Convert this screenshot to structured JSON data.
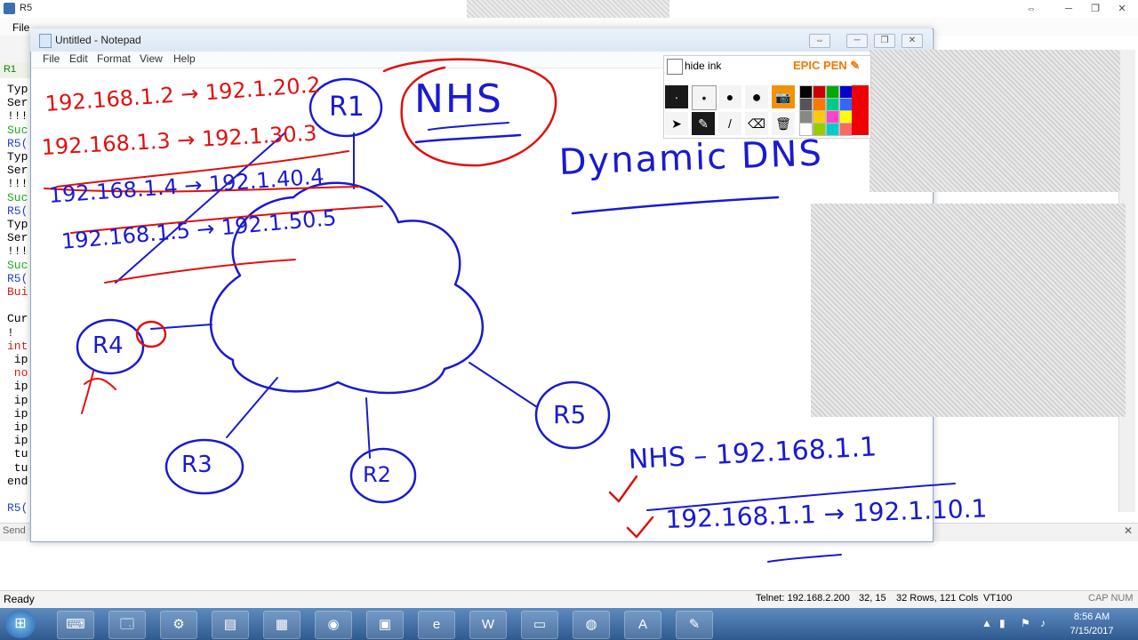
{
  "terminal": {
    "title": "R5",
    "menu_file": "File",
    "tab_label": "R1",
    "send_label": "Send",
    "lines": [
      {
        "text": "Typ",
        "color": "#000000"
      },
      {
        "text": "Ser",
        "color": "#000000"
      },
      {
        "text": "!!!",
        "color": "#000000"
      },
      {
        "text": "Suc",
        "color": "#22aa22"
      },
      {
        "text": "R5(",
        "color": "#2244cc"
      },
      {
        "text": "Typ",
        "color": "#000000"
      },
      {
        "text": "Ser",
        "color": "#000000"
      },
      {
        "text": "!!!",
        "color": "#000000"
      },
      {
        "text": "Suc",
        "color": "#22aa22"
      },
      {
        "text": "R5(",
        "color": "#2244cc"
      },
      {
        "text": "Typ",
        "color": "#000000"
      },
      {
        "text": "Ser",
        "color": "#000000"
      },
      {
        "text": "!!!",
        "color": "#000000"
      },
      {
        "text": "Suc",
        "color": "#22aa22"
      },
      {
        "text": "R5(",
        "color": "#2244cc"
      },
      {
        "text": "Bui",
        "color": "#cc2222"
      },
      {
        "text": "",
        "color": "#000000"
      },
      {
        "text": "Cur",
        "color": "#000000"
      },
      {
        "text": "!",
        "color": "#000000"
      },
      {
        "text": "int",
        "color": "#cc2222"
      },
      {
        "text": " ip",
        "color": "#000000"
      },
      {
        "text": " no",
        "color": "#cc2222"
      },
      {
        "text": " ip",
        "color": "#000000"
      },
      {
        "text": " ip",
        "color": "#000000"
      },
      {
        "text": " ip",
        "color": "#000000"
      },
      {
        "text": " ip",
        "color": "#000000"
      },
      {
        "text": " ip",
        "color": "#000000"
      },
      {
        "text": " tu",
        "color": "#000000"
      },
      {
        "text": " tu",
        "color": "#000000"
      },
      {
        "text": "end",
        "color": "#000000"
      },
      {
        "text": "",
        "color": "#000000"
      },
      {
        "text": "R5(",
        "color": "#2244cc"
      }
    ]
  },
  "status": {
    "ready": "Ready",
    "telnet": "Telnet: 192.168.2.200",
    "position": "32, 15",
    "rows_cols": "32 Rows, 121 Cols",
    "terminal_type": "VT100",
    "caps": "CAP  NUM"
  },
  "notepad": {
    "title": "Untitled - Notepad",
    "menu": [
      "File",
      "Edit",
      "Format",
      "View",
      "Help"
    ]
  },
  "epic_pen": {
    "hide_ink_label": "hide ink",
    "brand": "EPIC PEN",
    "colors_row1": [
      "#000000",
      "#cc0000",
      "#00aa00",
      "#0000cc"
    ],
    "colors_row2": [
      "#555555",
      "#ff7700",
      "#00cc88",
      "#3366ff"
    ],
    "colors_row3": [
      "#888888",
      "#ffcc00",
      "#ff44cc",
      "#ffff00"
    ],
    "colors_row4": [
      "#ffffff",
      "#99cc00",
      "#00cccc",
      "#ff6666"
    ],
    "active_color": "#ee0000"
  },
  "whiteboard": {
    "nodes": [
      "R1",
      "R4",
      "R3",
      "R2",
      "R5"
    ],
    "hub": "NHS",
    "heading": "Dynamic DNS",
    "mappings": [
      "192.168.1.2 → 192.1.20.2",
      "192.168.1.3 → 192.1.30.3",
      "192.168.1.4 → 192.1.40.4",
      "192.168.1.5 → 192.1.50.5"
    ],
    "nhs_line": "NHS – 192.168.1.1",
    "resolution_line": "192.168.1.1 → 192.1.10.1"
  },
  "taskbar": {
    "apps": [
      "putty-icon",
      "explorer-icon",
      "network-icon",
      "notepad-icon",
      "tablet-icon",
      "chrome-icon",
      "word-doc-icon",
      "ie-icon",
      "word-icon",
      "folder-icon",
      "camera-icon",
      "acrobat-icon",
      "epicpen-icon"
    ],
    "time": "8:56 AM",
    "date": "7/15/2017"
  }
}
